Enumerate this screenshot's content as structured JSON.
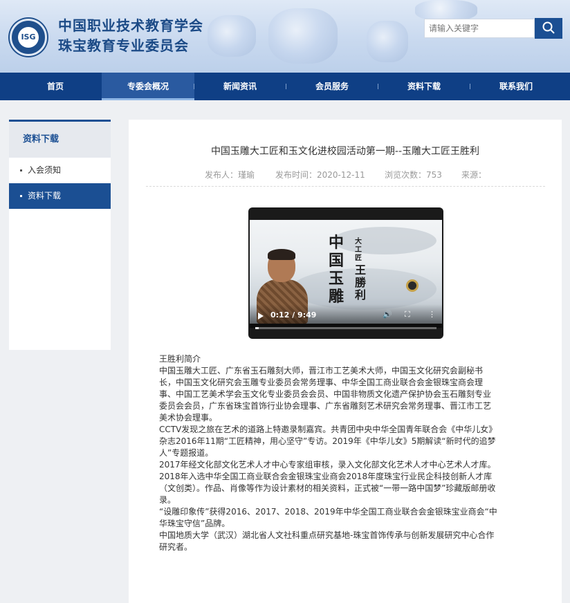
{
  "header": {
    "org_name_line1": "中国职业技术教育学会",
    "org_name_line2": "珠宝教育专业委员会",
    "logo_text": "ISG",
    "search": {
      "placeholder": "请输入关键字",
      "icon": "search-icon"
    },
    "colors": {
      "brand": "#1b4a86",
      "nav_bg": "#0f3f85"
    }
  },
  "nav": {
    "items": [
      {
        "label": "首页"
      },
      {
        "label": "专委会概况",
        "active": true
      },
      {
        "label": "新闻资讯"
      },
      {
        "label": "会员服务"
      },
      {
        "label": "资料下载"
      },
      {
        "label": "联系我们"
      }
    ]
  },
  "sidebar": {
    "title": "资料下载",
    "items": [
      {
        "label": "入会须知"
      },
      {
        "label": "资料下载",
        "active": true
      }
    ]
  },
  "article": {
    "title": "中国玉雕大工匠和玉文化进校园活动第一期--玉雕大工匠王胜利",
    "meta": {
      "author": "发布人：瑾瑜",
      "date": "发布时间：2020-12-11",
      "views": "浏览次数：753",
      "source": "来源："
    },
    "video": {
      "calligraphy_main": "中国玉雕",
      "calligraphy_sub": "大工匠",
      "calligraphy_name": "王勝利",
      "time": "0:12 / 9:49",
      "progress_fraction": 0.02
    },
    "bio": [
      "王胜利简介",
      "中国玉雕大工匠、广东省玉石雕刻大师，晋江市工艺美术大师，中国玉文化研究会副秘书长，中国玉文化研究会玉雕专业委员会常务理事、中华全国工商业联合会金银珠宝商会理事、中国工艺美术学会玉文化专业委员会会员、中国非物质文化遗产保护协会玉石雕刻专业委员会会员，广东省珠宝首饰行业协会理事、广东省雕刻艺术研究会常务理事、晋江市工艺美术协会理事。",
      "CCTV发现之旅在艺术的道路上特邀录制嘉宾。共青团中央中华全国青年联合会《中华儿女》杂志2016年11期“工匠精神，用心坚守”专访。2019年《中华儿女》5期解读“新时代的追梦人”专题报道。",
      "2017年经文化部文化艺术人才中心专家组审核，录入文化部文化艺术人才中心艺术人才库。2018年入选中华全国工商业联合会金银珠宝业商会2018年度珠宝行业民企科技创新人才库（文创类）。作品、肖像等作为设计素材的相关资料，正式被“一带一路中国梦”珍藏版邮册收录。",
      "“设雕印象传”获得2016、2017、2018、2019年中华全国工商业联合会金银珠宝业商会“中华珠宝守信”品牌。",
      "中国地质大学（武汉）湖北省人文社科重点研究基地-珠宝首饰传承与创新发展研究中心合作研究者。"
    ]
  }
}
